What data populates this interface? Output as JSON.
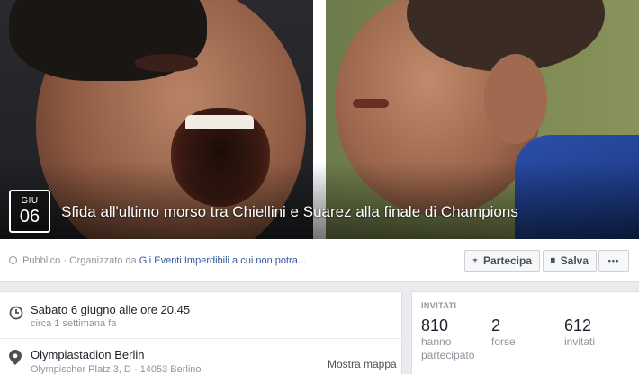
{
  "event": {
    "date_month": "GIU",
    "date_day": "06",
    "title": "Sfida all'ultimo morso tra Chiellini e Suarez alla finale di Champions"
  },
  "meta": {
    "privacy": "Pubblico",
    "separator": "·",
    "organized_by_prefix": "Organizzato da",
    "organizer": "Gli Eventi Imperdibili a cui non potra..."
  },
  "actions": {
    "join_label": "Partecipa",
    "save_label": "Salva",
    "more_label": "•••"
  },
  "details": {
    "time_main": "Sabato 6 giugno alle ore 20.45",
    "time_sub": "circa 1 settimana fa",
    "place_main": "Olympiastadion Berlin",
    "place_sub": "Olympischer Platz 3, D - 14053 Berlino",
    "map_link": "Mostra mappa"
  },
  "invited": {
    "heading": "INVITATI",
    "stats": [
      {
        "count": "810",
        "label": "hanno partecipato"
      },
      {
        "count": "2",
        "label": "forse"
      },
      {
        "count": "612",
        "label": "invitati"
      }
    ]
  },
  "icons": {
    "privacy": "globe-icon",
    "join": "join-icon",
    "save": "bookmark-icon",
    "time": "clock-icon",
    "place": "location-pin-icon"
  },
  "colors": {
    "link": "#365899",
    "muted": "#90949c",
    "page_bg": "#e9ebee"
  }
}
